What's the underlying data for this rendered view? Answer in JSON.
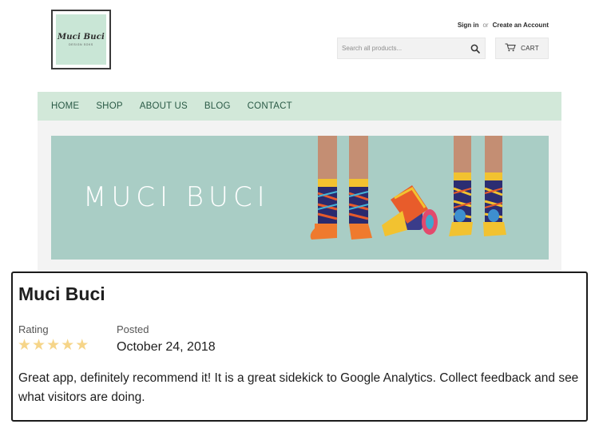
{
  "logo": {
    "text": "Muci Buci",
    "subtext": "DESIGN SOKS"
  },
  "header": {
    "sign_in": "Sign in",
    "or": "or",
    "create_account": "Create an Account",
    "search_placeholder": "Search all products...",
    "cart_label": "CART"
  },
  "nav": {
    "items": [
      {
        "label": "HOME"
      },
      {
        "label": "SHOP"
      },
      {
        "label": "ABOUT US"
      },
      {
        "label": "BLOG"
      },
      {
        "label": "CONTACT"
      }
    ]
  },
  "banner": {
    "title": "MUCI BUCI"
  },
  "review": {
    "title": "Muci Buci",
    "rating_label": "Rating",
    "rating": 5,
    "rating_max": 5,
    "star_color": "#f6d589",
    "posted_label": "Posted",
    "posted_date": "October 24, 2018",
    "body": "Great app, definitely recommend it! It is a great sidekick to Google Analytics. Collect feedback and see what visitors are doing."
  },
  "colors": {
    "nav_bg": "#d2e8d9",
    "banner_bg": "#a9cdc5",
    "nav_text": "#2a5a46"
  }
}
